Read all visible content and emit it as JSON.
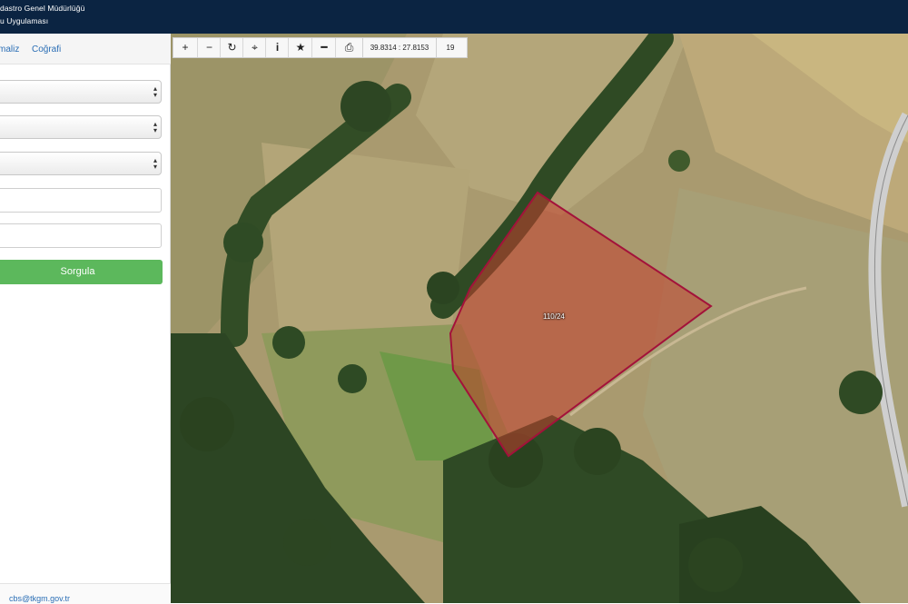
{
  "header": {
    "line1": "dastro Genel Müdürlüğü",
    "line2": "u Uygulaması"
  },
  "sidebar": {
    "tabs": [
      {
        "label": "maliz"
      },
      {
        "label": "Coğrafi"
      }
    ],
    "query_button_label": "Sorgula",
    "footer_email": "cbs@tkgm.gov.tr"
  },
  "toolbar": {
    "zoom_in": "+",
    "zoom_out": "−",
    "refresh": "↻",
    "locate": "⌖",
    "info": "i",
    "favorite": "★",
    "measure": "━",
    "print": "⎙",
    "coordinates": "39.8314 : 27.8153",
    "zoom_level": "19"
  },
  "map": {
    "parcel_label": "110/24",
    "parcel_stroke": "#a3123a",
    "parcel_fill": "#c2402d"
  },
  "icons": {
    "zoom_in": "plus-icon",
    "zoom_out": "minus-icon",
    "refresh": "refresh-icon",
    "locate": "crosshair-icon",
    "info": "info-icon",
    "favorite": "star-icon",
    "measure": "ruler-icon",
    "print": "printer-icon"
  }
}
